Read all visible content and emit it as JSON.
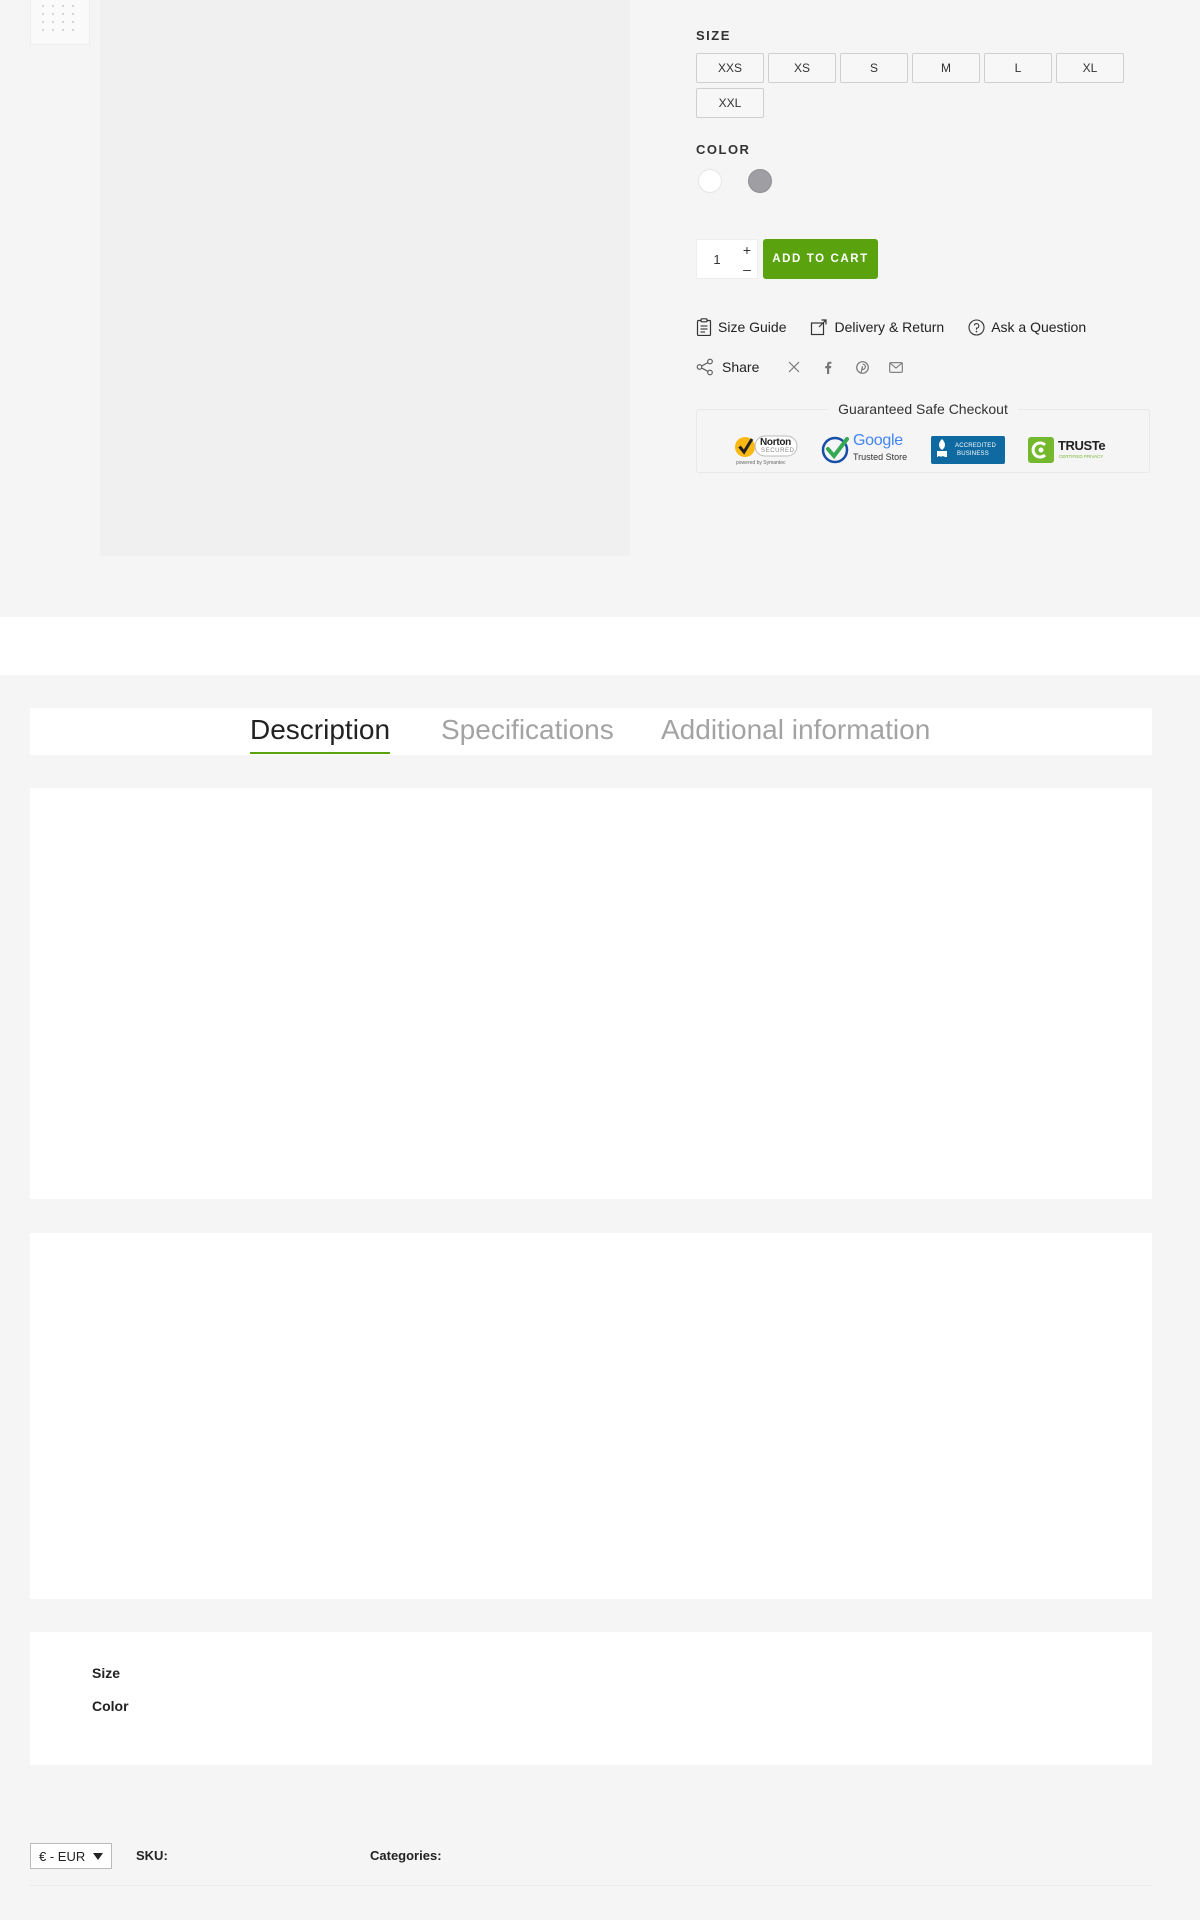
{
  "product": {
    "size": {
      "label": "SIZE",
      "options": [
        "XXS",
        "XS",
        "S",
        "M",
        "L",
        "XL",
        "XXL"
      ]
    },
    "color": {
      "label": "COLOR",
      "swatches": [
        {
          "name": "white",
          "hex": "#ffffff"
        },
        {
          "name": "gray",
          "hex": "#9e9ea3"
        }
      ]
    },
    "quantity": {
      "value": "1",
      "increase": "+",
      "decrease": "–"
    },
    "add_to_cart": "ADD TO CART"
  },
  "links": {
    "size_guide": "Size Guide",
    "delivery_return": "Delivery & Return",
    "ask_question": "Ask a Question"
  },
  "share": {
    "label": "Share",
    "networks": [
      "x-icon",
      "facebook-icon",
      "pinterest-icon",
      "email-icon"
    ]
  },
  "safe_checkout": {
    "title": "Guaranteed Safe Checkout",
    "badges": {
      "norton": {
        "name": "Norton",
        "sub": "SECURED",
        "powered": "powered by Symantec"
      },
      "google": {
        "name": "Google",
        "sub": "Trusted Store"
      },
      "bbb": {
        "name": "BBB",
        "line1": "ACCREDITED",
        "line2": "BUSINESS"
      },
      "truste": {
        "name": "TRUSTe",
        "sub": "CERTIFIED PRIVACY"
      }
    }
  },
  "tabs": {
    "description": "Description",
    "specifications": "Specifications",
    "additional_information": "Additional information"
  },
  "attributes": {
    "size_label": "Size",
    "color_label": "Color"
  },
  "footer_meta": {
    "currency": "€ - EUR",
    "sku_label": "SKU:",
    "categories_label": "Categories:"
  },
  "colors": {
    "accent": "#5aa30e",
    "page_background": "#f5f5f5",
    "panel_background": "#ffffff"
  }
}
